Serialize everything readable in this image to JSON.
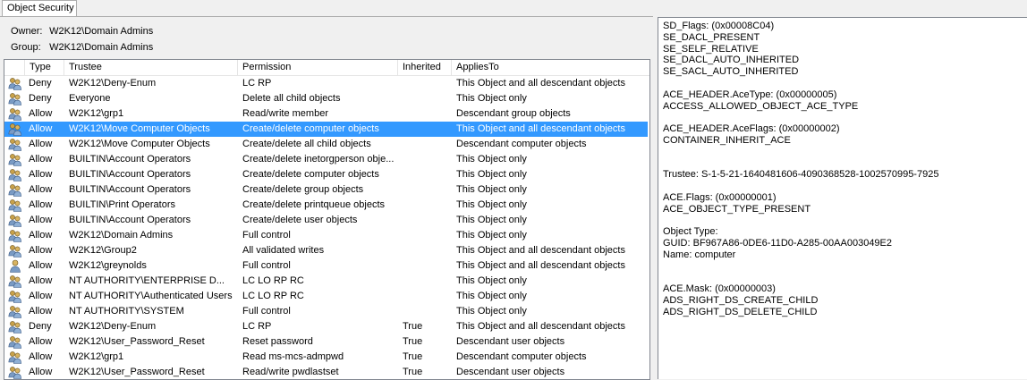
{
  "tab": {
    "label": "Object Security"
  },
  "owner": {
    "label": "Owner:",
    "value": "W2K12\\Domain Admins"
  },
  "group": {
    "label": "Group:",
    "value": "W2K12\\Domain Admins"
  },
  "columns": [
    "Type",
    "Trustee",
    "Permission",
    "Inherited",
    "AppliesTo"
  ],
  "rows": [
    {
      "icon": "group-icon",
      "type": "Deny",
      "trustee": "W2K12\\Deny-Enum",
      "permission": "LC RP",
      "inherited": "",
      "applies": "This Object and all descendant objects"
    },
    {
      "icon": "group-icon",
      "type": "Deny",
      "trustee": "Everyone",
      "permission": "Delete all child objects",
      "inherited": "",
      "applies": "This Object only"
    },
    {
      "icon": "group-icon",
      "type": "Allow",
      "trustee": "W2K12\\grp1",
      "permission": "Read/write member",
      "inherited": "",
      "applies": "Descendant group objects"
    },
    {
      "icon": "group-icon",
      "type": "Allow",
      "trustee": "W2K12\\Move Computer Objects",
      "permission": "Create/delete computer objects",
      "inherited": "",
      "applies": "This Object and all descendant objects",
      "selected": true
    },
    {
      "icon": "group-icon",
      "type": "Allow",
      "trustee": "W2K12\\Move Computer Objects",
      "permission": "Create/delete all child objects",
      "inherited": "",
      "applies": "Descendant computer objects"
    },
    {
      "icon": "group-icon",
      "type": "Allow",
      "trustee": "BUILTIN\\Account Operators",
      "permission": "Create/delete inetorgperson obje...",
      "inherited": "",
      "applies": "This Object only"
    },
    {
      "icon": "group-icon",
      "type": "Allow",
      "trustee": "BUILTIN\\Account Operators",
      "permission": "Create/delete computer objects",
      "inherited": "",
      "applies": "This Object only"
    },
    {
      "icon": "group-icon",
      "type": "Allow",
      "trustee": "BUILTIN\\Account Operators",
      "permission": "Create/delete group objects",
      "inherited": "",
      "applies": "This Object only"
    },
    {
      "icon": "group-icon",
      "type": "Allow",
      "trustee": "BUILTIN\\Print Operators",
      "permission": "Create/delete printqueue objects",
      "inherited": "",
      "applies": "This Object only"
    },
    {
      "icon": "group-icon",
      "type": "Allow",
      "trustee": "BUILTIN\\Account Operators",
      "permission": "Create/delete user objects",
      "inherited": "",
      "applies": "This Object only"
    },
    {
      "icon": "group-icon",
      "type": "Allow",
      "trustee": "W2K12\\Domain Admins",
      "permission": "Full control",
      "inherited": "",
      "applies": "This Object only"
    },
    {
      "icon": "group-icon",
      "type": "Allow",
      "trustee": "W2K12\\Group2",
      "permission": "All validated writes",
      "inherited": "",
      "applies": "This Object and all descendant objects"
    },
    {
      "icon": "user-icon",
      "type": "Allow",
      "trustee": "W2K12\\greynolds",
      "permission": "Full control",
      "inherited": "",
      "applies": "This Object and all descendant objects"
    },
    {
      "icon": "group-icon",
      "type": "Allow",
      "trustee": "NT AUTHORITY\\ENTERPRISE D...",
      "permission": "LC LO RP RC",
      "inherited": "",
      "applies": "This Object only"
    },
    {
      "icon": "group-icon",
      "type": "Allow",
      "trustee": "NT AUTHORITY\\Authenticated Users",
      "permission": "LC LO RP RC",
      "inherited": "",
      "applies": "This Object only"
    },
    {
      "icon": "group-icon",
      "type": "Allow",
      "trustee": "NT AUTHORITY\\SYSTEM",
      "permission": "Full control",
      "inherited": "",
      "applies": "This Object only"
    },
    {
      "icon": "group-icon",
      "type": "Deny",
      "trustee": "W2K12\\Deny-Enum",
      "permission": "LC RP",
      "inherited": "True",
      "applies": "This Object and all descendant objects"
    },
    {
      "icon": "group-icon",
      "type": "Allow",
      "trustee": "W2K12\\User_Password_Reset",
      "permission": "Reset password",
      "inherited": "True",
      "applies": "Descendant user objects"
    },
    {
      "icon": "group-icon",
      "type": "Allow",
      "trustee": "W2K12\\grp1",
      "permission": "Read ms-mcs-admpwd",
      "inherited": "True",
      "applies": "Descendant computer objects"
    },
    {
      "icon": "group-icon",
      "type": "Allow",
      "trustee": "W2K12\\User_Password_Reset",
      "permission": "Read/write pwdlastset",
      "inherited": "True",
      "applies": "Descendant user objects"
    }
  ],
  "details": [
    "SD_Flags: (0x00008C04)",
    "SE_DACL_PRESENT",
    "SE_SELF_RELATIVE",
    "SE_DACL_AUTO_INHERITED",
    "SE_SACL_AUTO_INHERITED",
    "",
    "ACE_HEADER.AceType: (0x00000005)",
    "ACCESS_ALLOWED_OBJECT_ACE_TYPE",
    "",
    "ACE_HEADER.AceFlags: (0x00000002)",
    "CONTAINER_INHERIT_ACE",
    "",
    "",
    "Trustee: S-1-5-21-1640481606-4090368528-1002570995-7925",
    "",
    "ACE.Flags: (0x00000001)",
    "ACE_OBJECT_TYPE_PRESENT",
    "",
    "Object Type:",
    "GUID: BF967A86-0DE6-11D0-A285-00AA003049E2",
    "Name: computer",
    "",
    "",
    "ACE.Mask: (0x00000003)",
    "ADS_RIGHT_DS_CREATE_CHILD",
    "ADS_RIGHT_DS_DELETE_CHILD"
  ],
  "colors": {
    "selection": "#3399ff",
    "border": "#828790",
    "background": "#f0f0f0"
  }
}
